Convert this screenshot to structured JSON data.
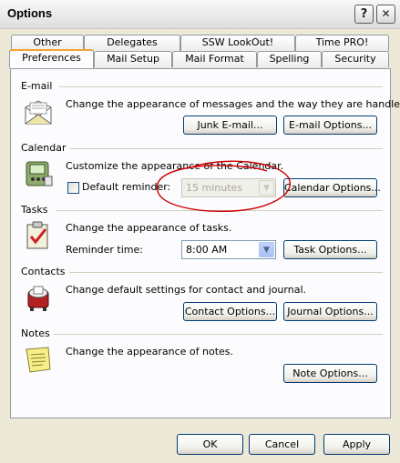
{
  "window": {
    "title": "Options",
    "help_glyph": "?",
    "close_glyph": "✕"
  },
  "tabs": {
    "back_row": [
      "Other",
      "Delegates",
      "SSW LookOut!",
      "Time PRO!"
    ],
    "front_row": [
      "Preferences",
      "Mail Setup",
      "Mail Format",
      "Spelling",
      "Security"
    ],
    "active": "Preferences"
  },
  "email": {
    "heading": "E-mail",
    "description": "Change the appearance of messages and the way they are handled.",
    "junk_button": "Junk E-mail...",
    "options_button": "E-mail Options...",
    "icon": "envelope-icon"
  },
  "calendar": {
    "heading": "Calendar",
    "description": "Customize the appearance of the Calendar.",
    "reminder_label": "Default reminder:",
    "reminder_checked": false,
    "reminder_value": "15 minutes",
    "options_button": "Calendar Options...",
    "icon": "calendar-pda-icon",
    "annotation_color": "#cc0000"
  },
  "tasks": {
    "heading": "Tasks",
    "description": "Change the appearance of tasks.",
    "reminder_label": "Reminder time:",
    "reminder_value": "8:00 AM",
    "options_button": "Task Options...",
    "icon": "task-clipboard-icon"
  },
  "contacts": {
    "heading": "Contacts",
    "description": "Change default settings for contact and journal.",
    "contact_button": "Contact Options...",
    "journal_button": "Journal Options...",
    "icon": "rolodex-icon"
  },
  "notes": {
    "heading": "Notes",
    "description": "Change the appearance of notes.",
    "options_button": "Note Options...",
    "icon": "sticky-note-icon"
  },
  "footer": {
    "ok": "OK",
    "cancel": "Cancel",
    "apply": "Apply"
  }
}
